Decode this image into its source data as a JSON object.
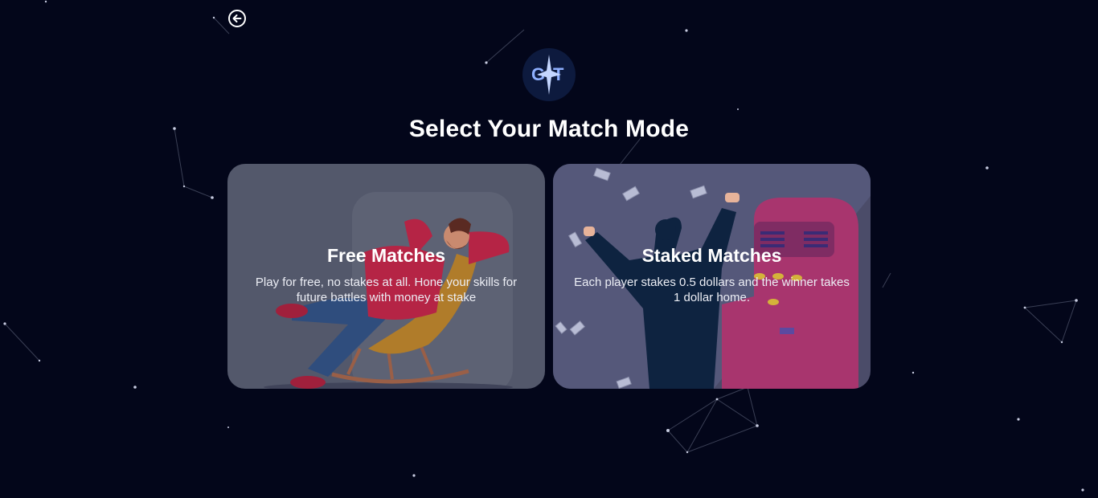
{
  "header": {
    "back_icon": "arrow-left-circle-icon",
    "logo_text": "GT",
    "title": "Select Your Match Mode"
  },
  "modes": [
    {
      "title": "Free Matches",
      "description": "Play for free, no stakes at all. Hone your skills for future battles with money at stake",
      "illustration": "man-relaxing-in-rocking-chair"
    },
    {
      "title": "Staked Matches",
      "description": "Each player stakes 0.5 dollars and the winner takes 1 dollar home.",
      "illustration": "man-celebrating-at-slot-machine-with-flying-money"
    }
  ],
  "colors": {
    "background": "#03061a",
    "logo_bg": "#0d1a3e",
    "logo_accent": "#8fb0ff",
    "card_free": "#53586b",
    "card_staked": "#4b4c69"
  }
}
